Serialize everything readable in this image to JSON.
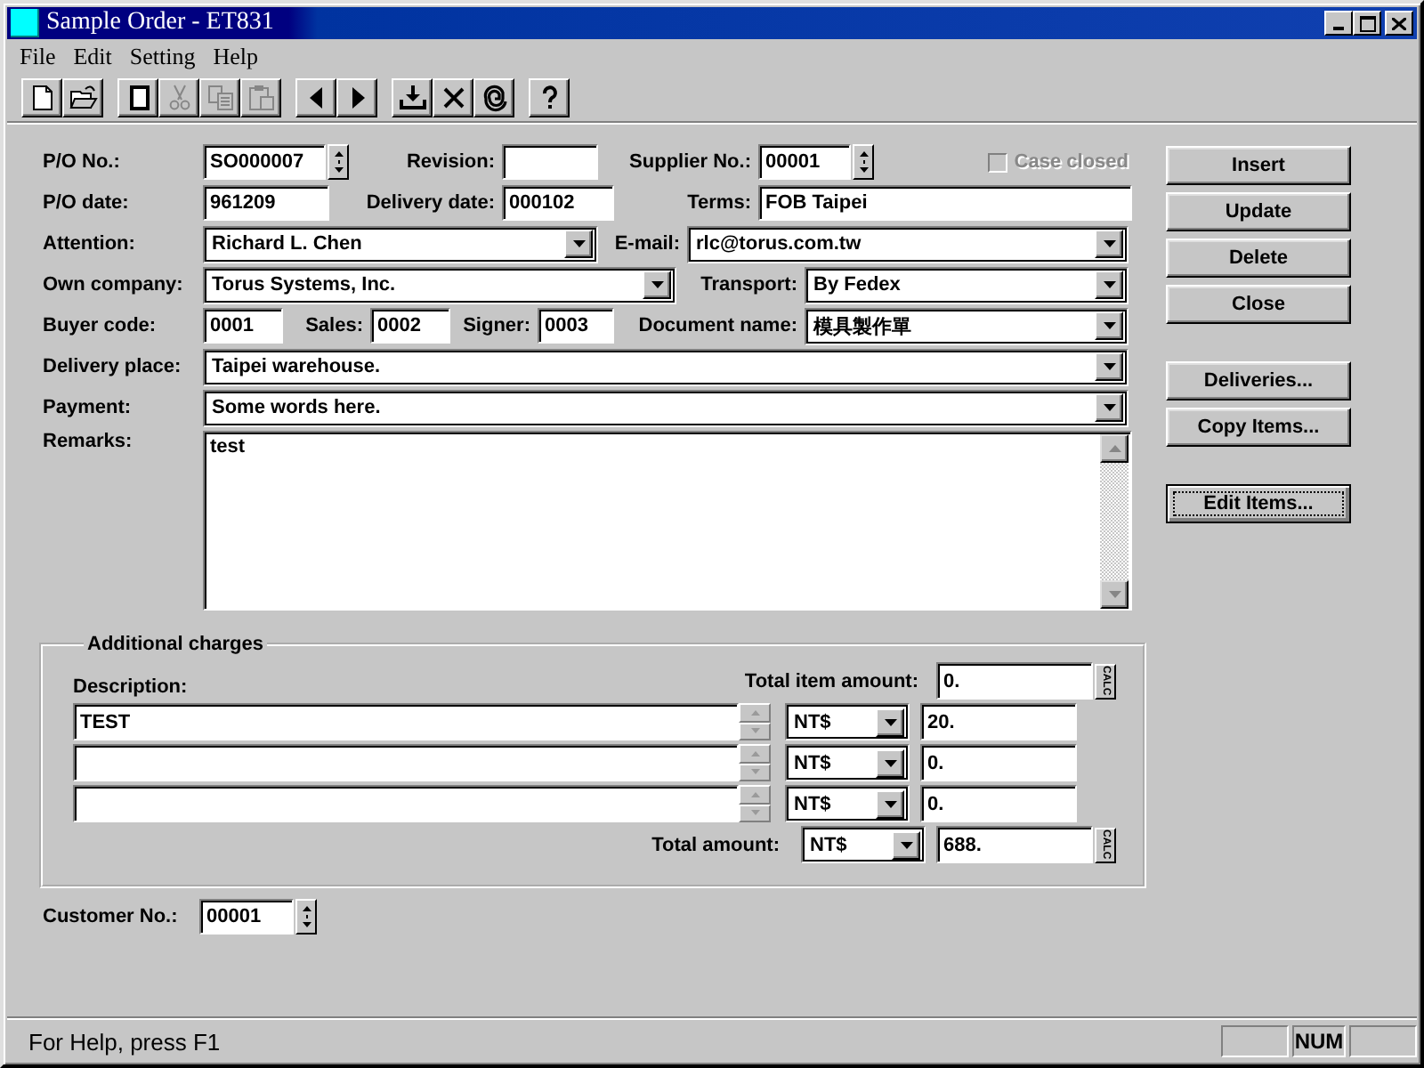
{
  "window": {
    "title": "Sample Order - ET831"
  },
  "menu": [
    {
      "label": "File"
    },
    {
      "label": "Edit"
    },
    {
      "label": "Setting"
    },
    {
      "label": "Help"
    }
  ],
  "toolbar": [
    [
      {
        "kind": "new",
        "disabled": false
      },
      {
        "kind": "open",
        "disabled": false
      }
    ],
    [
      {
        "kind": "page",
        "disabled": false
      },
      {
        "kind": "cut",
        "disabled": true
      },
      {
        "kind": "copy",
        "disabled": true
      },
      {
        "kind": "paste",
        "disabled": true
      }
    ],
    [
      {
        "kind": "prev",
        "disabled": false
      },
      {
        "kind": "next",
        "disabled": false
      }
    ],
    [
      {
        "kind": "import",
        "disabled": false
      },
      {
        "kind": "delete",
        "disabled": false
      },
      {
        "kind": "refresh",
        "disabled": false
      }
    ],
    [
      {
        "kind": "help",
        "disabled": false
      }
    ]
  ],
  "form": {
    "rows": [
      {
        "fields": [
          {
            "kind": "spin",
            "label": "P/O No.:",
            "value": "SO000007"
          },
          {
            "kind": "text",
            "label": "Revision:"
          },
          {
            "kind": "spin",
            "label": "Supplier No.:",
            "value": "00001"
          },
          {
            "kind": "checkbox",
            "label": "Case closed",
            "checked": false,
            "disabled": true
          }
        ]
      },
      {
        "fields": [
          {
            "kind": "text",
            "label": "P/O date:",
            "value": "961209"
          },
          {
            "kind": "text",
            "label": "Delivery date:",
            "value": "000102"
          },
          {
            "kind": "text",
            "label": "Terms:",
            "value": "FOB Taipei"
          }
        ]
      },
      {
        "fields": [
          {
            "kind": "combo",
            "label": "Attention:",
            "value": "Richard L. Chen"
          },
          {
            "kind": "combo",
            "label": "E-mail:",
            "value": "rlc@torus.com.tw"
          }
        ]
      },
      {
        "fields": [
          {
            "kind": "combo",
            "label": "Own company:",
            "value": "Torus Systems, Inc."
          },
          {
            "kind": "combo",
            "label": "Transport:",
            "value": "By Fedex"
          }
        ]
      },
      {
        "fields": [
          {
            "kind": "text",
            "label": "Buyer code:",
            "value": "0001"
          },
          {
            "kind": "text",
            "label": "Sales:",
            "value": "0002"
          },
          {
            "kind": "text",
            "label": "Signer:",
            "value": "0003"
          },
          {
            "kind": "combo",
            "label": "Document name:",
            "value": "模具製作單"
          }
        ]
      },
      {
        "fields": [
          {
            "kind": "combo",
            "label": "Delivery place:",
            "value": "Taipei warehouse."
          }
        ]
      },
      {
        "fields": [
          {
            "kind": "combo",
            "label": "Payment:",
            "value": "Some words here."
          }
        ]
      }
    ],
    "remarks": {
      "label": "Remarks:",
      "value": "test"
    }
  },
  "buttons": [
    {
      "label": "Insert",
      "focused": false
    },
    {
      "label": "Update",
      "focused": false
    },
    {
      "label": "Delete",
      "focused": false
    },
    {
      "label": "Close",
      "focused": false
    },
    {
      "label": "Deliveries...",
      "focused": false
    },
    {
      "label": "Copy Items...",
      "focused": false
    },
    {
      "label": "Edit Items...",
      "focused": true
    }
  ],
  "additional_charges": {
    "title": "Additional charges",
    "description_label": "Description:",
    "total_item_amount": {
      "label": "Total item amount:",
      "value": "0.",
      "calc": "CALC"
    },
    "rows": [
      {
        "description": "TEST",
        "currency": "NT$",
        "amount": "20."
      },
      {
        "currency": "NT$",
        "amount": "0."
      },
      {
        "currency": "NT$",
        "amount": "0."
      }
    ],
    "total_amount": {
      "label": "Total amount:",
      "currency": "NT$",
      "value": "688.",
      "calc": "CALC"
    }
  },
  "customer": {
    "label": "Customer No.:",
    "value": "00001"
  },
  "status_bar": {
    "text": "For Help, press F1",
    "indicators": [
      {
        "text": "NUM"
      }
    ]
  }
}
